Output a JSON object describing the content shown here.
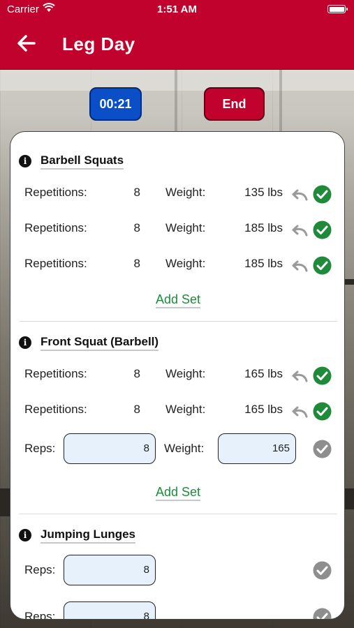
{
  "status_bar": {
    "carrier": "Carrier",
    "time": "1:51 AM"
  },
  "nav": {
    "title": "Leg Day"
  },
  "controls": {
    "timer": "00:21",
    "end": "End"
  },
  "exercises": [
    {
      "name": "Barbell Squats",
      "sets": [
        {
          "reps_label": "Repetitions:",
          "reps": "8",
          "weight_label": "Weight:",
          "weight": "135 lbs",
          "completed": true
        },
        {
          "reps_label": "Repetitions:",
          "reps": "8",
          "weight_label": "Weight:",
          "weight": "185 lbs",
          "completed": true
        },
        {
          "reps_label": "Repetitions:",
          "reps": "8",
          "weight_label": "Weight:",
          "weight": "185 lbs",
          "completed": true
        }
      ],
      "add_set": "Add Set"
    },
    {
      "name": "Front Squat (Barbell)",
      "sets": [
        {
          "reps_label": "Repetitions:",
          "reps": "8",
          "weight_label": "Weight:",
          "weight": "165 lbs",
          "completed": true
        },
        {
          "reps_label": "Repetitions:",
          "reps": "8",
          "weight_label": "Weight:",
          "weight": "165 lbs",
          "completed": true
        }
      ],
      "pending_set": {
        "reps_label": "Reps:",
        "reps": "8",
        "weight_label": "Weight:",
        "weight": "165",
        "completed": false
      },
      "add_set": "Add Set"
    },
    {
      "name": "Jumping Lunges",
      "pending_sets": [
        {
          "reps_label": "Reps:",
          "reps": "8",
          "completed": false
        },
        {
          "reps_label": "Reps:",
          "reps": "8",
          "completed": false
        }
      ]
    }
  ],
  "colors": {
    "brand_red": "#c0022c",
    "timer_blue": "#0a4fc7",
    "check_green": "#1f8a3a",
    "check_gray": "#8e8e8e",
    "input_bg": "#e6f1fb"
  },
  "icons": {
    "back": "arrow-left-icon",
    "info": "info-icon",
    "undo": "undo-icon",
    "check": "check-circle-icon"
  }
}
